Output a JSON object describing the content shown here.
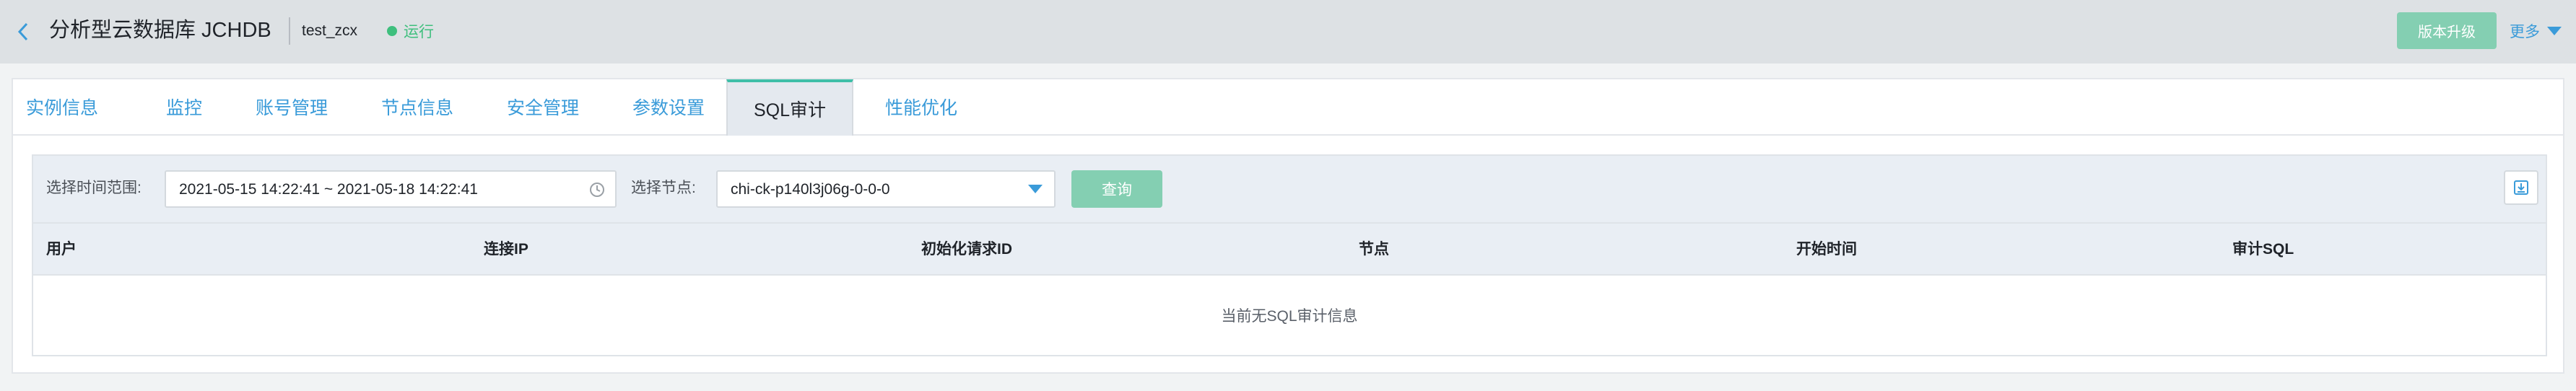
{
  "header": {
    "title": "分析型云数据库 JCHDB",
    "instance_name": "test_zcx",
    "status": "运行",
    "upgrade_label": "版本升级",
    "more_label": "更多"
  },
  "tabs": [
    {
      "label": "实例信息",
      "active": false
    },
    {
      "label": "监控",
      "active": false
    },
    {
      "label": "账号管理",
      "active": false
    },
    {
      "label": "节点信息",
      "active": false
    },
    {
      "label": "安全管理",
      "active": false
    },
    {
      "label": "参数设置",
      "active": false
    },
    {
      "label": "SQL审计",
      "active": true
    },
    {
      "label": "性能优化",
      "active": false
    }
  ],
  "filters": {
    "time_range_label": "选择时间范围:",
    "time_range_value": "2021-05-15 14:22:41 ~ 2021-05-18 14:22:41",
    "node_label": "选择节点:",
    "node_value": "chi-ck-p140l3j06g-0-0-0",
    "query_label": "查询"
  },
  "table": {
    "columns": [
      "用户",
      "连接IP",
      "初始化请求ID",
      "节点",
      "开始时间",
      "审计SQL"
    ],
    "empty_text": "当前无SQL审计信息"
  },
  "colors": {
    "accent": "#3a9bd9",
    "primary_button": "#84cfb2",
    "status_green": "#3ebf7d",
    "active_tab_border": "#3ebfa8"
  },
  "icons": {
    "back": "chevron-left-icon",
    "more": "caret-down-icon",
    "clock": "clock-icon",
    "node_dropdown": "caret-down-icon",
    "export": "download-icon"
  }
}
